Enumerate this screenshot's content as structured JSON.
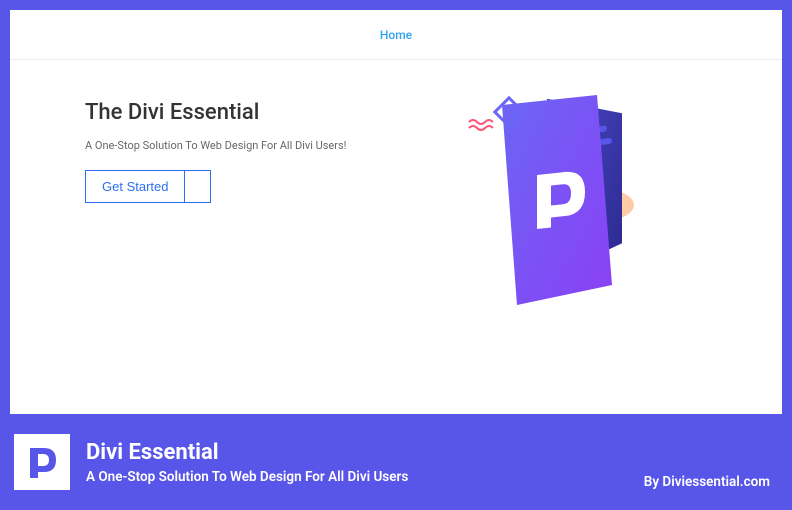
{
  "nav": {
    "home": "Home"
  },
  "hero": {
    "title": "The Divi Essential",
    "subtitle": "A One-Stop Solution To Web Design For All Divi Users!",
    "cta": "Get Started"
  },
  "footer": {
    "title": "Divi Essential",
    "subtitle": "A One-Stop Solution To Web Design For All Divi Users",
    "byline": "By Diviessential.com"
  },
  "colors": {
    "brand": "#5856e9",
    "accent": "#2ea3f2",
    "button": "#2e6ff2"
  }
}
